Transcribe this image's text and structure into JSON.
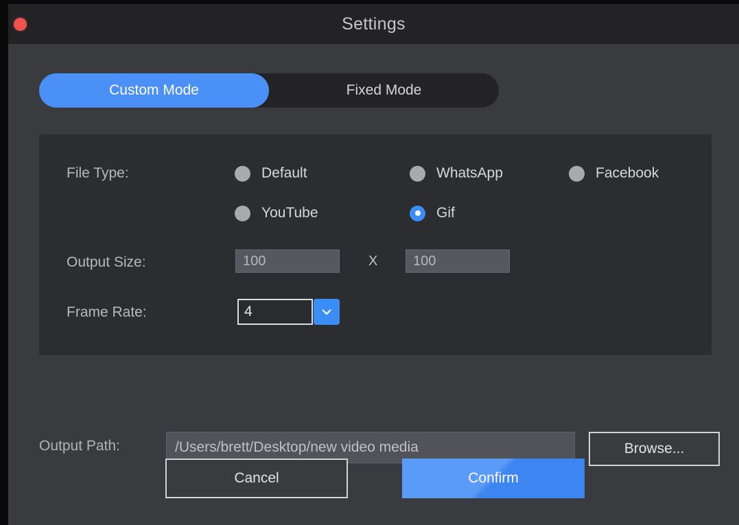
{
  "window": {
    "title": "Settings",
    "close_icon": "close-circle-icon"
  },
  "tabs": [
    {
      "label": "Custom Mode",
      "active": true
    },
    {
      "label": "Fixed Mode",
      "active": false
    }
  ],
  "settings_panel": {
    "file_type": {
      "label": "File Type:",
      "options": [
        {
          "label": "Default",
          "selected": false
        },
        {
          "label": "WhatsApp",
          "selected": false
        },
        {
          "label": "Facebook",
          "selected": false
        },
        {
          "label": "YouTube",
          "selected": false
        },
        {
          "label": "Gif",
          "selected": true
        }
      ]
    },
    "output_size": {
      "label": "Output Size:",
      "width_value": "100",
      "separator": "X",
      "height_value": "100"
    },
    "frame_rate": {
      "label": "Frame Rate:",
      "value": "4",
      "arrow_icon": "chevron-down-icon"
    }
  },
  "output_path": {
    "label": "Output Path:",
    "value": "/Users/brett/Desktop/new video media",
    "browse_label": "Browse..."
  },
  "actions": {
    "cancel_label": "Cancel",
    "confirm_label": "Confirm"
  },
  "colors": {
    "accent": "#4a90f7",
    "close": "#ef5350",
    "panel": "#2c2d31",
    "body": "#3a3b3e",
    "titlebar": "#232326"
  }
}
